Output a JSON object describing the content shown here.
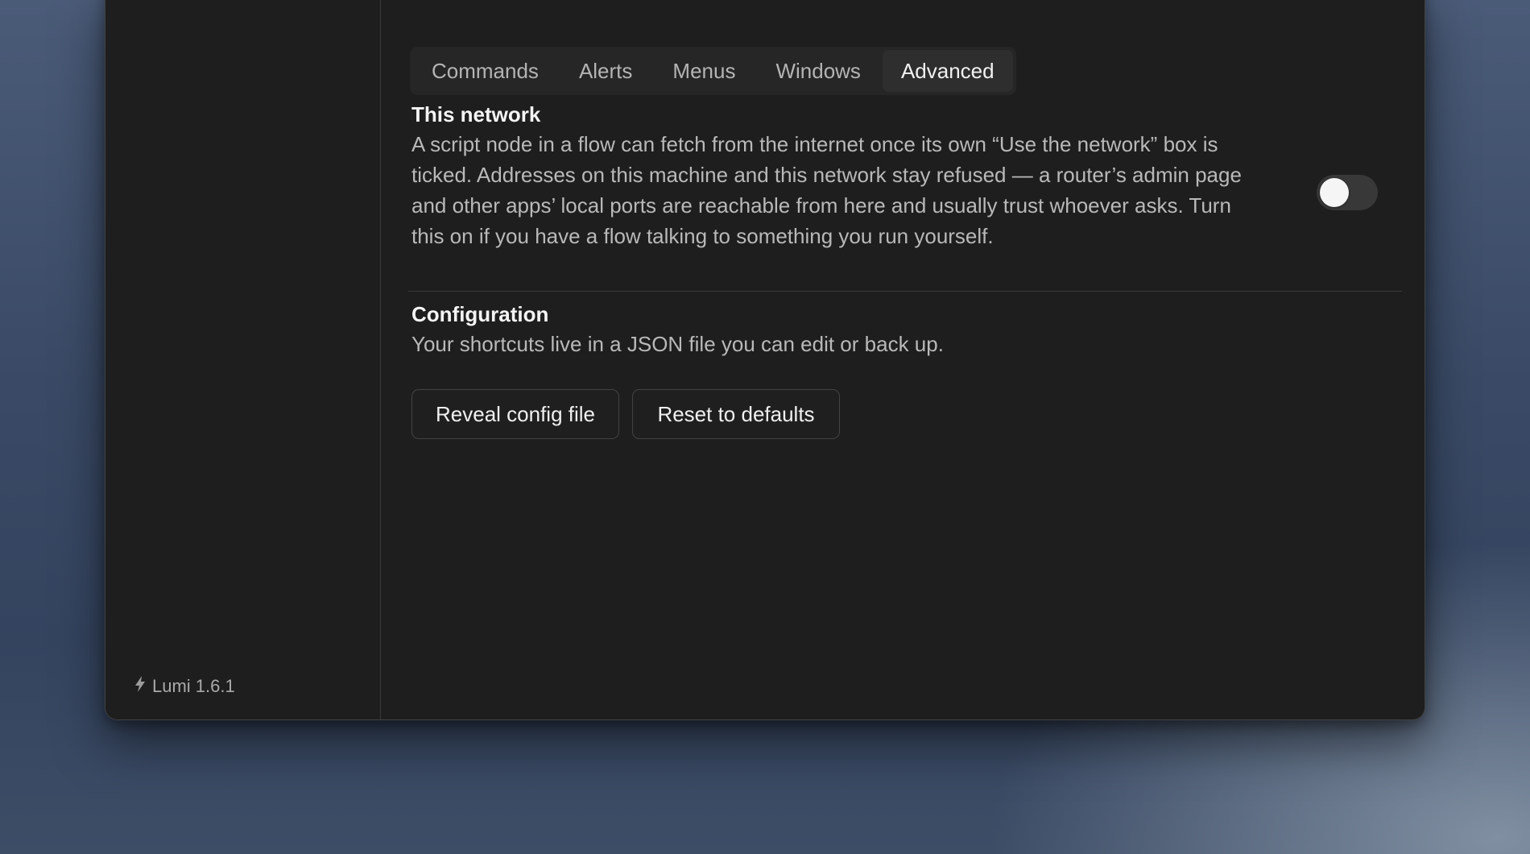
{
  "tabs": [
    {
      "label": "Commands",
      "active": false
    },
    {
      "label": "Alerts",
      "active": false
    },
    {
      "label": "Menus",
      "active": false
    },
    {
      "label": "Windows",
      "active": false
    },
    {
      "label": "Advanced",
      "active": true
    }
  ],
  "network": {
    "title": "This network",
    "lines": [
      "A script node in a flow can fetch from the internet once its own “Use the network” box is",
      "ticked. Addresses on this machine and this network stay refused — a router’s admin page",
      "and other apps’ local ports are reachable from here and usually trust whoever asks. Turn",
      "this on if you have a flow talking to something you run yourself."
    ],
    "toggle_on": false
  },
  "configuration": {
    "title": "Configuration",
    "description": "Your shortcuts live in a JSON file you can edit or back up.",
    "reveal_label": "Reveal config file",
    "reset_label": "Reset to defaults"
  },
  "sidebar": {
    "version": "Lumi 1.6.1",
    "icon": "bolt-icon"
  },
  "colors": {
    "window_bg": "#1e1e1e",
    "toggle_off": "#383838"
  }
}
